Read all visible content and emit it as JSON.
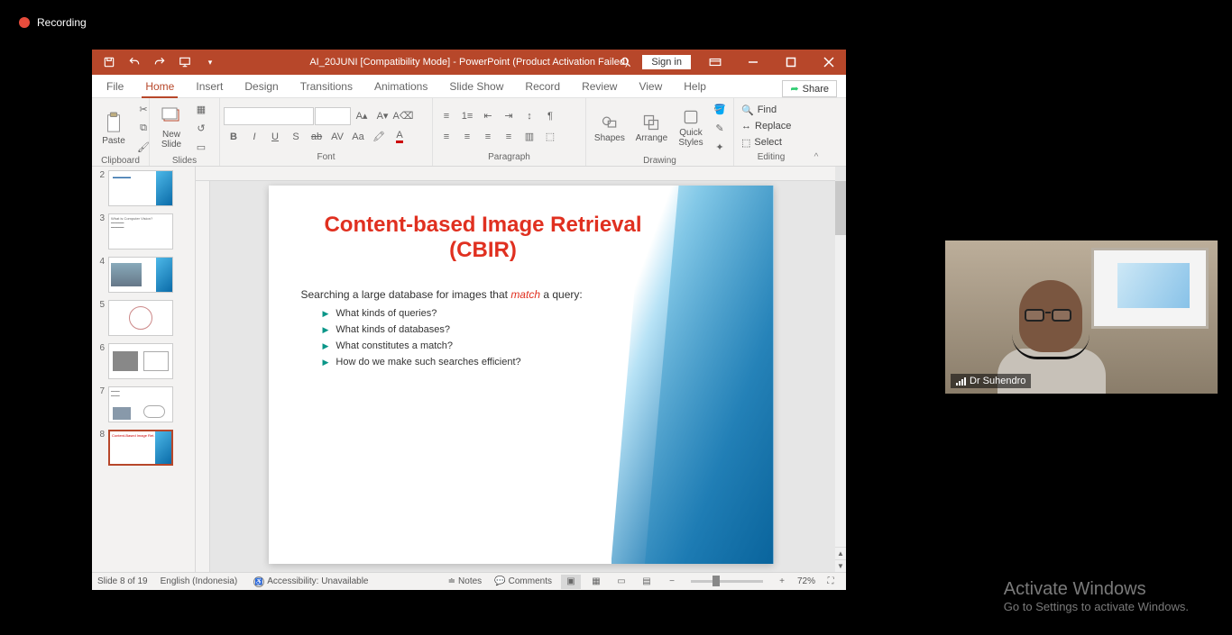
{
  "recording_label": "Recording",
  "titlebar": {
    "title": "AI_20JUNI [Compatibility Mode]  -  PowerPoint (Product Activation Failed)",
    "signin": "Sign in"
  },
  "tabs": {
    "file": "File",
    "home": "Home",
    "insert": "Insert",
    "design": "Design",
    "transitions": "Transitions",
    "animations": "Animations",
    "slideshow": "Slide Show",
    "record": "Record",
    "review": "Review",
    "view": "View",
    "help": "Help",
    "share": "Share"
  },
  "ribbon": {
    "clipboard": {
      "label": "Clipboard",
      "paste": "Paste"
    },
    "slides": {
      "label": "Slides",
      "new": "New\nSlide"
    },
    "font": {
      "label": "Font"
    },
    "paragraph": {
      "label": "Paragraph"
    },
    "drawing": {
      "label": "Drawing",
      "shapes": "Shapes",
      "arrange": "Arrange",
      "quick": "Quick\nStyles"
    },
    "editing": {
      "label": "Editing",
      "find": "Find",
      "replace": "Replace",
      "select": "Select"
    }
  },
  "thumbnails": [
    {
      "num": "2"
    },
    {
      "num": "3"
    },
    {
      "num": "4"
    },
    {
      "num": "5"
    },
    {
      "num": "6"
    },
    {
      "num": "7"
    },
    {
      "num": "8"
    }
  ],
  "slide": {
    "title": "Content-based Image Retrieval (CBIR)",
    "subtitle_pre": "Searching a large database for images that ",
    "subtitle_em": "match",
    "subtitle_post": " a query:",
    "bullets": [
      "What kinds of queries?",
      "What kinds of databases?",
      "What constitutes a match?",
      "How do we make such searches efficient?"
    ]
  },
  "statusbar": {
    "slide": "Slide 8 of 19",
    "lang": "English (Indonesia)",
    "acc": "Accessibility: Unavailable",
    "notes": "Notes",
    "comments": "Comments",
    "zoom": "72%"
  },
  "webcam": {
    "presenter": "Dr Suhendro"
  },
  "activate": {
    "title": "Activate Windows",
    "sub": "Go to Settings to activate Windows."
  }
}
